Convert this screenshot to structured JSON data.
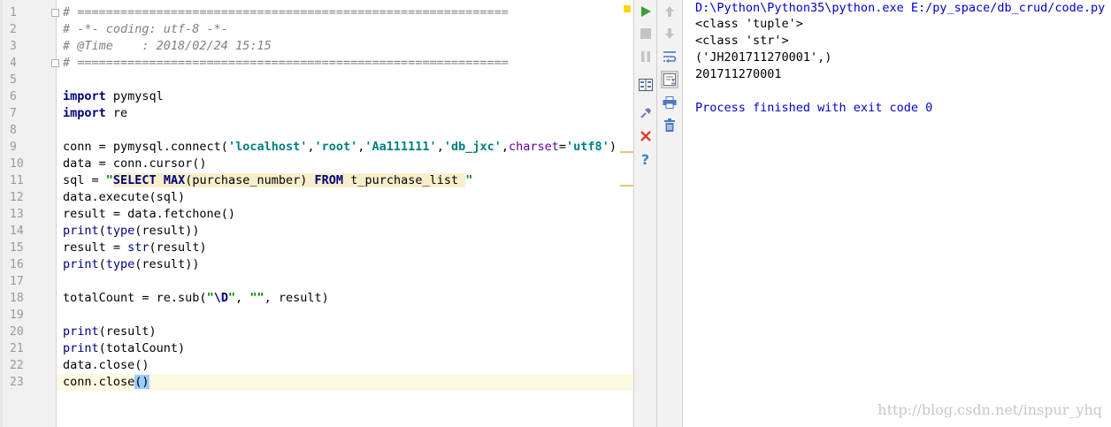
{
  "editor": {
    "line_numbers": [
      "1",
      "2",
      "3",
      "4",
      "5",
      "6",
      "7",
      "8",
      "9",
      "10",
      "11",
      "12",
      "13",
      "14",
      "15",
      "16",
      "17",
      "18",
      "19",
      "20",
      "21",
      "22",
      "23"
    ],
    "current_line": 23,
    "code": {
      "l1": "# ============================================================",
      "l2": "# -*- coding: utf-8 -*-",
      "l3": "# @Time    : 2018/02/24 15:15",
      "l4": "# ============================================================",
      "kw_import": "import",
      "l6_rest": " pymysql",
      "l7_rest": " re",
      "l9_a": "conn = pymysql.connect(",
      "l9_s1": "'localhost'",
      "comma": ",",
      "l9_s2": "'root'",
      "l9_s3": "'Aa111111'",
      "l9_s4": "'db_jxc'",
      "l9_param": "charset",
      "l9_eq": "=",
      "l9_s5": "'utf8'",
      "l9_close": ")",
      "l10": "data = conn.cursor()",
      "l11_a": "sql = ",
      "l11_q1": "\"",
      "l11_select": "SELECT",
      "l11_sp": " ",
      "l11_max": "MAX",
      "l11_mid": "(purchase_number) ",
      "l11_from": "FROM",
      "l11_table": " t_purchase_list ",
      "l11_q2": "\"",
      "l12": "data.execute(sql)",
      "l13": "result = data.fetchone()",
      "print": "print",
      "type": "type",
      "str": "str",
      "l14_a": "(",
      "l14_b": "(result))",
      "l15_a": "result = ",
      "l15_b": "(result)",
      "l16_a": "(",
      "l16_b": "(result))",
      "l18_a": "totalCount = re.sub(",
      "l18_q": "\"",
      "l18_esc": "\\D",
      "l18_q2": "\"",
      "l18_sep": ", ",
      "l18_empty": "\"\"",
      "l18_b": ", result)",
      "l20_b": "(result)",
      "l21_b": "(totalCount)",
      "l22": "data.close()",
      "l23_a": "conn.close",
      "l23_b": "()"
    }
  },
  "toolbar_left": {
    "icons": [
      "run-icon",
      "stop-icon",
      "pause-icon",
      "layout-icon",
      "pin-icon",
      "close-icon",
      "help-icon"
    ],
    "help_glyph": "?"
  },
  "toolbar_right": {
    "icons": [
      "up-arrow-icon",
      "down-arrow-icon",
      "soft-wrap-icon",
      "scroll-to-end-icon",
      "print-icon",
      "trash-icon"
    ]
  },
  "console": {
    "lines": [
      "D:\\Python\\Python35\\python.exe E:/py_space/db_crud/code.py",
      "<class 'tuple'>",
      "<class 'str'>",
      "('JH201711270001',)",
      "201711270001",
      "",
      "Process finished with exit code 0"
    ]
  },
  "watermark": "http://blog.csdn.net/inspur_yhq",
  "colors": {
    "keyword": "#000080",
    "string": "#008080",
    "comment": "#808080",
    "console_blue": "#0000cc",
    "current_line": "#fdfae3"
  }
}
